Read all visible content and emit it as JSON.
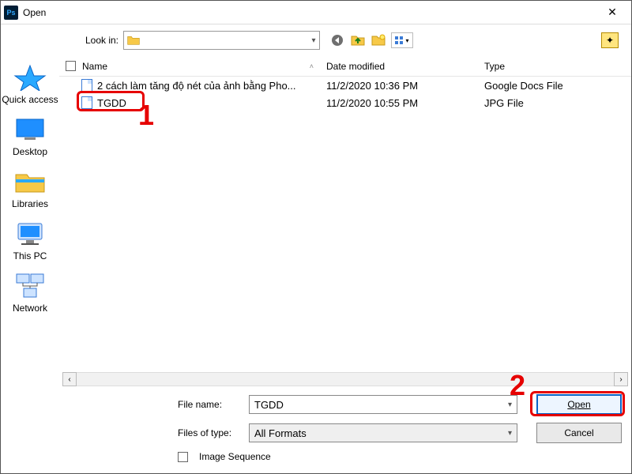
{
  "window": {
    "title": "Open",
    "close_glyph": "✕"
  },
  "lookin": {
    "label": "Look in:",
    "value": ""
  },
  "toolbar": {
    "back_glyph": "◀",
    "up_glyph": "📂",
    "new_glyph": "📁",
    "view_glyph": "▦",
    "view_caret": "▾",
    "star_glyph": "✦"
  },
  "places": [
    {
      "label": "Quick access"
    },
    {
      "label": "Desktop"
    },
    {
      "label": "Libraries"
    },
    {
      "label": "This PC"
    },
    {
      "label": "Network"
    }
  ],
  "columns": {
    "name": "Name",
    "date": "Date modified",
    "type": "Type"
  },
  "files": [
    {
      "name": "2 cách làm tăng độ nét của ảnh bằng Pho...",
      "date": "11/2/2020 10:36 PM",
      "type": "Google Docs File"
    },
    {
      "name": "TGDD",
      "date": "11/2/2020 10:55 PM",
      "type": "JPG File"
    }
  ],
  "form": {
    "filename_label": "File name:",
    "filename_value": "TGDD",
    "types_label": "Files of type:",
    "types_value": "All Formats",
    "open_label": "Open",
    "cancel_label": "Cancel",
    "imgseq_label": "Image Sequence"
  },
  "annotations": {
    "one": "1",
    "two": "2"
  }
}
